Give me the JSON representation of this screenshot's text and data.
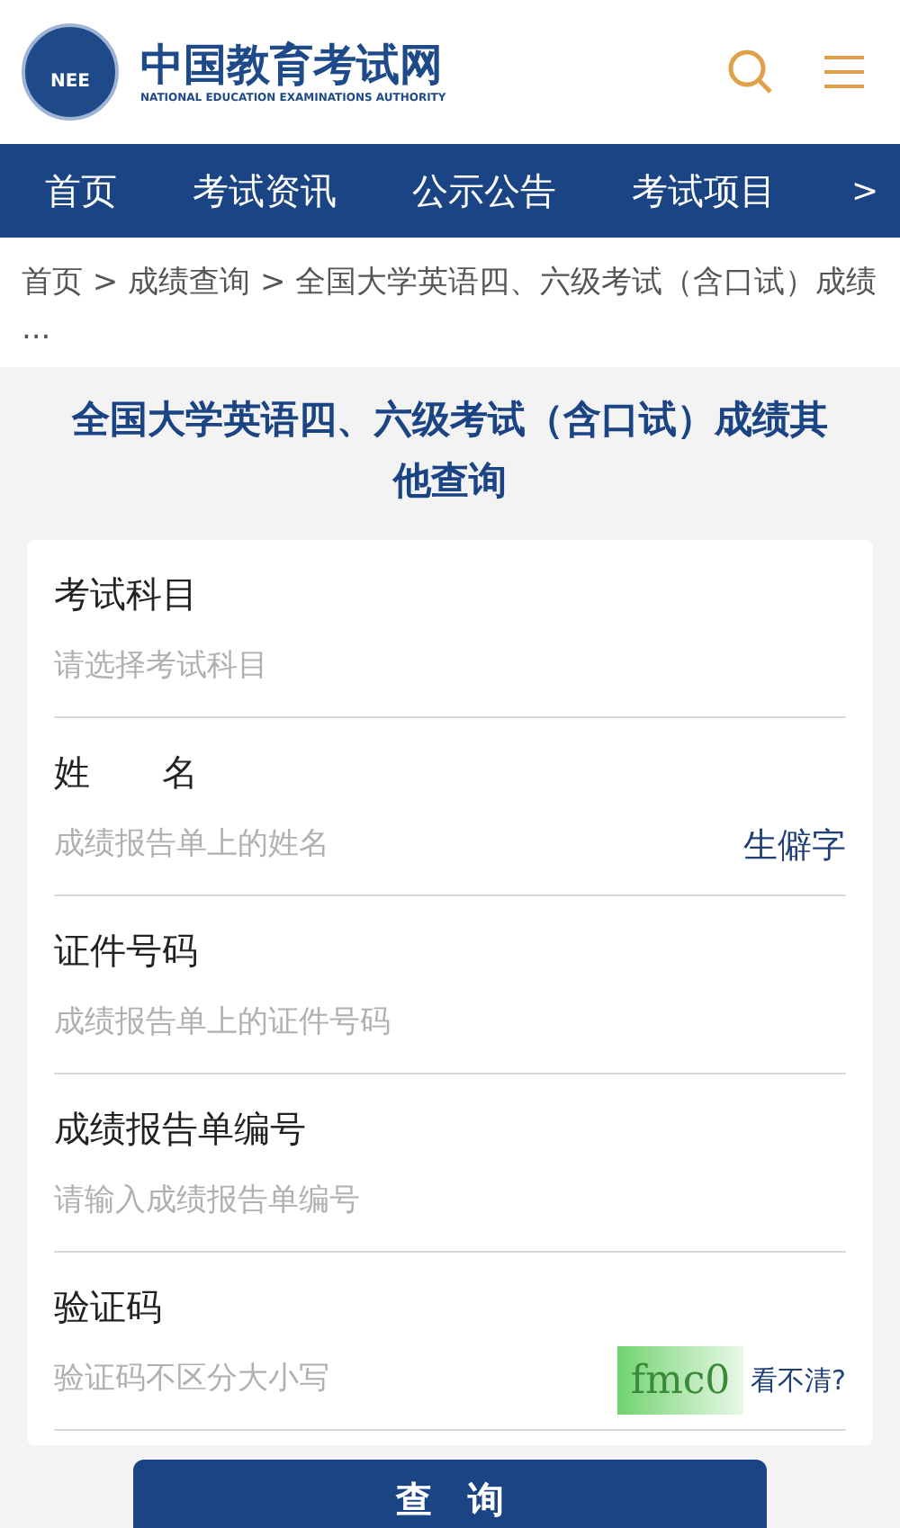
{
  "header": {
    "logo_mark": "NEE",
    "site_name": "中国教育考试网",
    "site_name_en": "NATIONAL EDUCATION EXAMINATIONS AUTHORITY"
  },
  "nav": {
    "items": [
      {
        "label": "首页"
      },
      {
        "label": "考试资讯"
      },
      {
        "label": "公示公告"
      },
      {
        "label": "考试项目"
      }
    ],
    "more": ">"
  },
  "breadcrumb": {
    "text": "首页 > 成绩查询 > 全国大学英语四、六级考试（含口试）成绩 ..."
  },
  "title": "全国大学英语四、六级考试（含口试）成绩其他查询",
  "form": {
    "fields": [
      {
        "kind": "plain",
        "label": "考试科目",
        "placeholder": "请选择考试科目"
      },
      {
        "kind": "link",
        "label": "姓　　名",
        "placeholder": "成绩报告单上的姓名",
        "link": "生僻字"
      },
      {
        "kind": "plain",
        "label": "证件号码",
        "placeholder": "成绩报告单上的证件号码"
      },
      {
        "kind": "plain",
        "label": "成绩报告单编号",
        "placeholder": "请输入成绩报告单编号"
      },
      {
        "kind": "captcha",
        "label": "验证码",
        "placeholder": "验证码不区分大小写",
        "captcha": "fmc0",
        "link": "看不清?"
      }
    ]
  },
  "submit": "查　询"
}
